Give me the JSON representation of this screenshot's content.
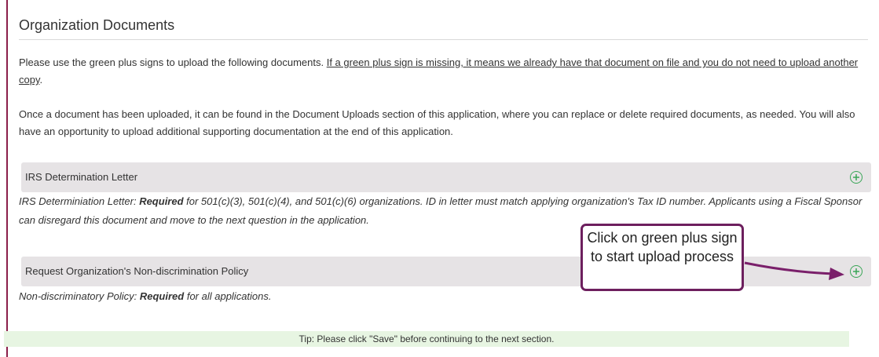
{
  "section": {
    "title": "Organization Documents"
  },
  "intro": {
    "text_a": "Please use the green plus signs to upload the following documents. ",
    "underline": "If a green plus sign is missing, it means we already have that document on file and you do not need to upload another copy",
    "text_end": ".",
    "paragraph2": "Once a document has been uploaded, it can be found in the Document Uploads section of this application, where you can replace or delete required documents, as needed. You will also have an opportunity to upload additional supporting documentation at the end of this application."
  },
  "documents": [
    {
      "label": "IRS Determination Letter",
      "desc_prefix": "IRS Determiniation Letter: ",
      "required": "Required",
      "desc_suffix": " for 501(c)(3), 501(c)(4), and 501(c)(6) organizations. ID in letter must match applying organization's Tax ID number. Applicants using a Fiscal Sponsor can disregard this document and move to the next question in the application."
    },
    {
      "label": "Request Organization's Non-discrimination Policy",
      "desc_prefix": "Non-discriminatory Policy: ",
      "required": "Required",
      "desc_suffix": " for all applications."
    }
  ],
  "callout": {
    "text": "Click on green plus sign to start upload process"
  },
  "tip": {
    "text": "Tip: Please click \"Save\" before continuing to the next section."
  },
  "colors": {
    "accent_green": "#3aa657",
    "callout_border": "#6d1f5e",
    "left_rule": "#8b1f4a"
  }
}
